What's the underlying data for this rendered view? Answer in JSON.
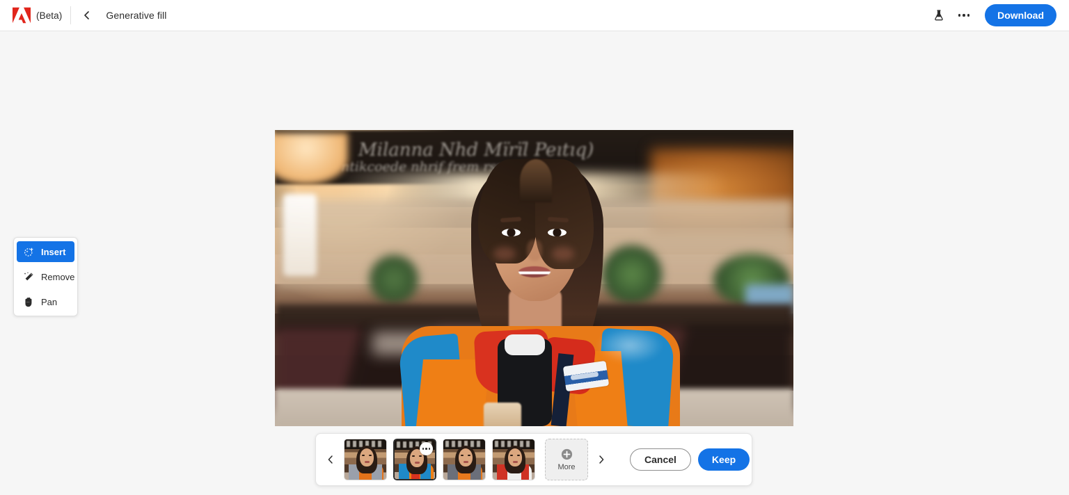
{
  "header": {
    "logo_icon": "adobe-logo",
    "beta_label": "(Beta)",
    "back_icon": "chevron-left-icon",
    "doc_title": "Generative fill",
    "flask_icon": "flask-icon",
    "more_icon": "more-horizontal-icon",
    "download_label": "Download"
  },
  "tool_panel": {
    "items": [
      {
        "label": "Insert",
        "icon": "insert-sparkle-icon",
        "selected": true
      },
      {
        "label": "Remove",
        "icon": "magic-wand-icon",
        "selected": false
      },
      {
        "label": "Pan",
        "icon": "hand-icon",
        "selected": false
      }
    ]
  },
  "canvas": {
    "alt": "Portrait of a woman in a colorblock orange, blue and red jacket standing in a blurred cafe interior with a chalkboard menu behind her"
  },
  "filmstrip": {
    "prev_icon": "chevron-left-icon",
    "next_icon": "chevron-right-icon",
    "thumbnails": [
      {
        "name": "variation-1",
        "selected": false,
        "jacket": "#e3721a",
        "accent": "#9aa0ab"
      },
      {
        "name": "variation-2",
        "selected": true,
        "jacket": "#ef7f15",
        "accent": "#1f8ac9"
      },
      {
        "name": "variation-3",
        "selected": false,
        "jacket": "#e8791d",
        "accent": "#6b6f7a"
      },
      {
        "name": "variation-4",
        "selected": false,
        "jacket": "#f0f0ee",
        "accent": "#cf3324"
      }
    ],
    "thumb_badge_icon": "more-horizontal-icon",
    "more": {
      "label": "More",
      "icon": "plus-circle-icon"
    },
    "cancel_label": "Cancel",
    "keep_label": "Keep"
  },
  "colors": {
    "accent_blue": "#1473e6",
    "page_bg": "#f6f6f6",
    "header_bg": "#ffffff",
    "text": "#2c2c2c"
  }
}
